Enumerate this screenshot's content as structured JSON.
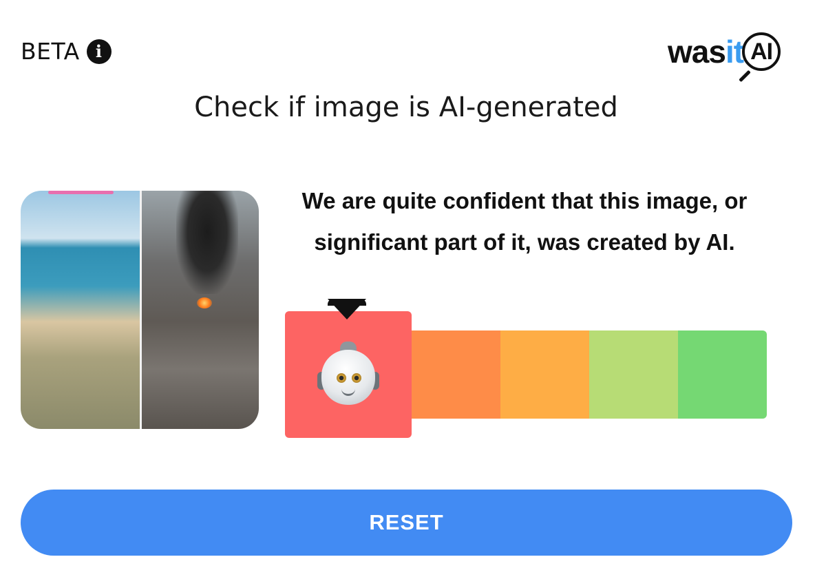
{
  "header": {
    "beta_label": "BETA",
    "info_icon": "info-icon",
    "logo": {
      "part1": "was",
      "part2": "it",
      "part3": "AI"
    }
  },
  "title": "Check if image is AI-generated",
  "result": {
    "message": "We are quite confident that this image, or significant part of it, was created by AI.",
    "active_icon": "robot-icon"
  },
  "meter": {
    "selected_index": 0,
    "segments": [
      {
        "color": "#fd6463"
      },
      {
        "color": "#fe8c48"
      },
      {
        "color": "#fead45"
      },
      {
        "color": "#b7dc75"
      },
      {
        "color": "#75d873"
      }
    ]
  },
  "image": {
    "description_icon": "image-thumbnail"
  },
  "colors": {
    "accent": "#428bf3",
    "logo_it": "#3a9cf0"
  },
  "actions": {
    "reset_label": "RESET"
  }
}
